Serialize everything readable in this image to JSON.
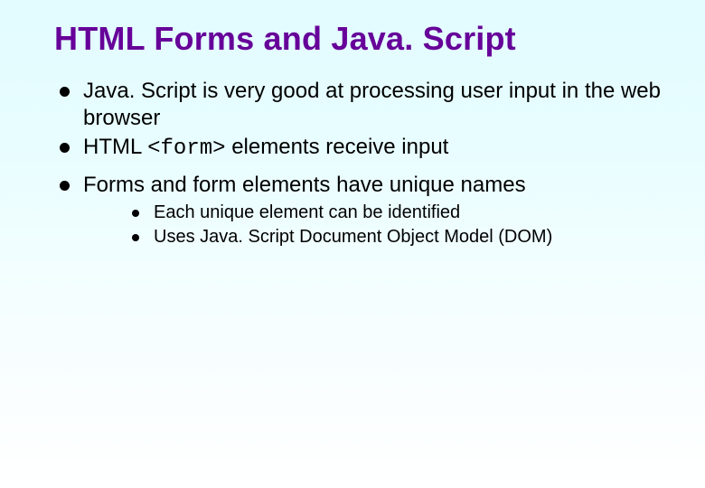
{
  "title": "HTML Forms and Java. Script",
  "bullets": {
    "b1": "Java. Script is very good at processing user input in the web browser",
    "b2_pre": "HTML ",
    "b2_code": "<form>",
    "b2_post": " elements receive input",
    "b3": "Forms and form elements have unique names",
    "sub": {
      "s1": "Each unique element can be identified",
      "s2": "Uses Java. Script Document Object Model (DOM)"
    }
  }
}
